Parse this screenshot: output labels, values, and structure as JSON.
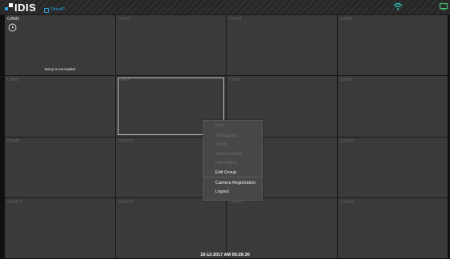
{
  "header": {
    "logo_text": "IDIS",
    "logo_sub": "DirectIP",
    "wifi_icon": "wifi-icon",
    "monitor_icon": "monitor-icon"
  },
  "colors": {
    "accent": "#2aa3e0",
    "wifi": "#34d7d0",
    "monitor": "#4ccc7a"
  },
  "cells": [
    {
      "label": "CAM1",
      "message": "Setup is not loaded",
      "active": true
    },
    {
      "label": "CAM2"
    },
    {
      "label": "CAM3"
    },
    {
      "label": "CAM4"
    },
    {
      "label": "CAM5"
    },
    {
      "label": "CAM6",
      "selected": true
    },
    {
      "label": "CAM7"
    },
    {
      "label": "CAM8"
    },
    {
      "label": "CAM9"
    },
    {
      "label": "CAM10"
    },
    {
      "label": "CAM11"
    },
    {
      "label": "CAM12"
    },
    {
      "label": "CAM13"
    },
    {
      "label": "CAM14"
    },
    {
      "label": "CAM15"
    },
    {
      "label": "CAM16"
    }
  ],
  "context_menu": {
    "items": [
      {
        "label": "PTZ",
        "enabled": false
      },
      {
        "label": "Debugging",
        "enabled": false
      },
      {
        "label": "Zoom",
        "enabled": false
      },
      {
        "label": "Color Control",
        "enabled": false
      },
      {
        "label": "Information",
        "enabled": false
      },
      {
        "label": "Edit Group",
        "enabled": true
      },
      {
        "label": "Camera Registration",
        "enabled": true
      },
      {
        "label": "Logout",
        "enabled": true
      }
    ]
  },
  "status": {
    "datetime": "10-12-2017 AM 05:26:30"
  }
}
